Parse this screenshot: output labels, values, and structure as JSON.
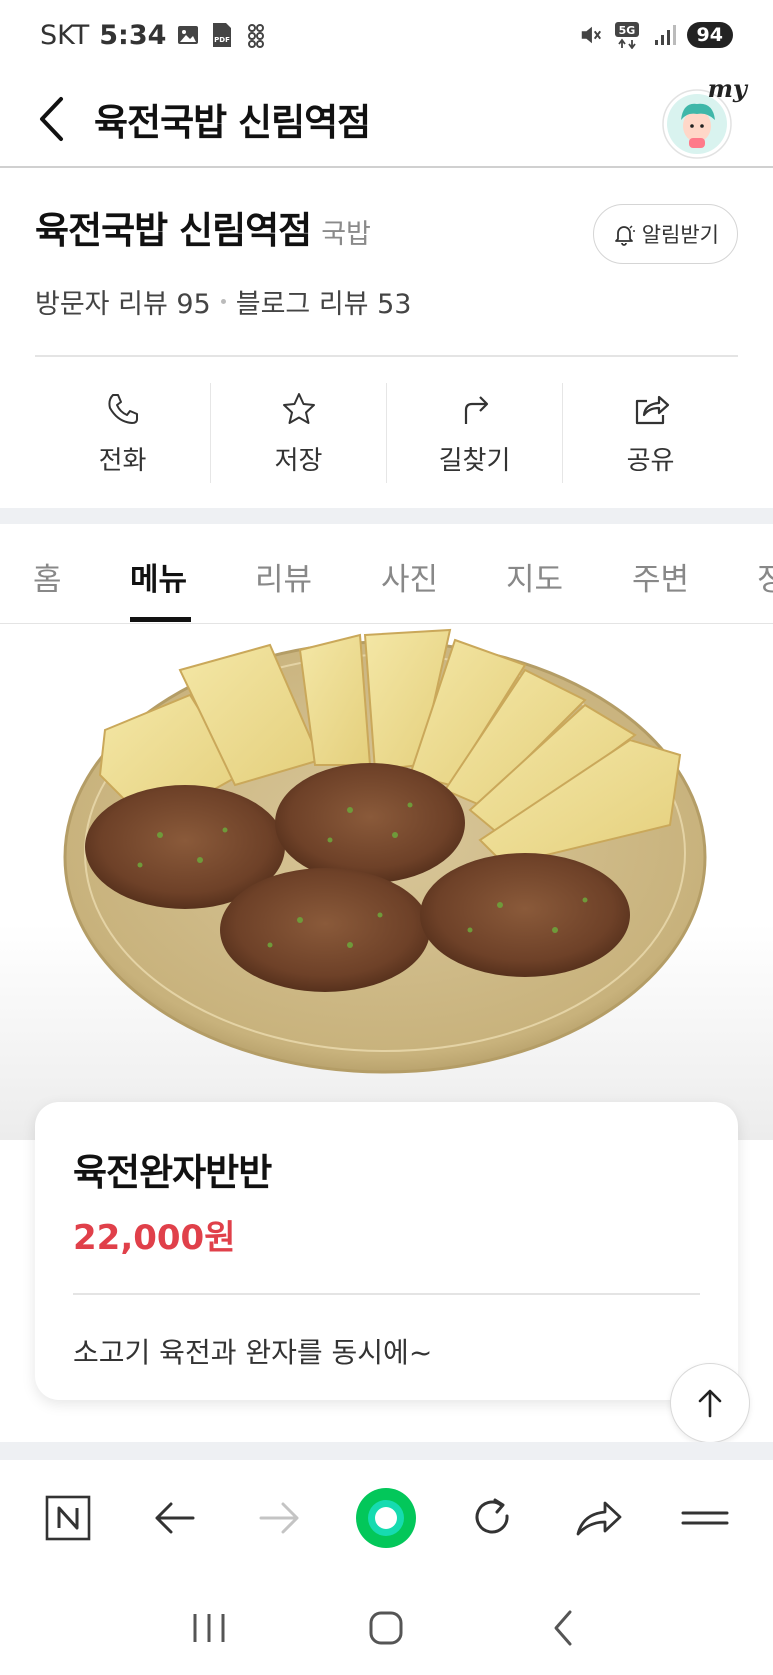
{
  "status_bar": {
    "carrier": "SKT",
    "time": "5:34",
    "battery": "94",
    "network": "5G",
    "left_icons": [
      "image-icon",
      "pdf-icon",
      "app-icon"
    ],
    "right_icons": [
      "mute-icon",
      "5g-icon",
      "signal-icon",
      "battery-icon"
    ]
  },
  "header": {
    "title": "육전국밥 신림역점",
    "my_label": "my"
  },
  "place": {
    "name": "육전국밥 신림역점",
    "category": "국밥",
    "notify_label": "알림받기",
    "visitor_reviews": "방문자 리뷰 95",
    "blog_reviews": "블로그 리뷰 53"
  },
  "actions": [
    {
      "label": "전화",
      "icon": "phone-icon"
    },
    {
      "label": "저장",
      "icon": "star-icon"
    },
    {
      "label": "길찾기",
      "icon": "directions-icon"
    },
    {
      "label": "공유",
      "icon": "share-icon"
    }
  ],
  "tabs": [
    {
      "label": "홈",
      "active": false
    },
    {
      "label": "메뉴",
      "active": true
    },
    {
      "label": "리뷰",
      "active": false
    },
    {
      "label": "사진",
      "active": false
    },
    {
      "label": "지도",
      "active": false
    },
    {
      "label": "주변",
      "active": false
    },
    {
      "label": "정",
      "active": false
    }
  ],
  "menu": {
    "name": "육전완자반반",
    "price": "22,000원",
    "description": "소고기 육전과 완자를 동시에~",
    "price_color": "#e0404a"
  },
  "toolbar": {
    "items": [
      "naver-home-icon",
      "back-arrow-icon",
      "forward-arrow-icon",
      "green-dot-icon",
      "refresh-icon",
      "share-arrow-icon",
      "menu-icon"
    ],
    "accent_color": "#03c75a"
  },
  "system_nav": {
    "items": [
      "recent-apps-icon",
      "home-icon",
      "back-icon"
    ]
  }
}
